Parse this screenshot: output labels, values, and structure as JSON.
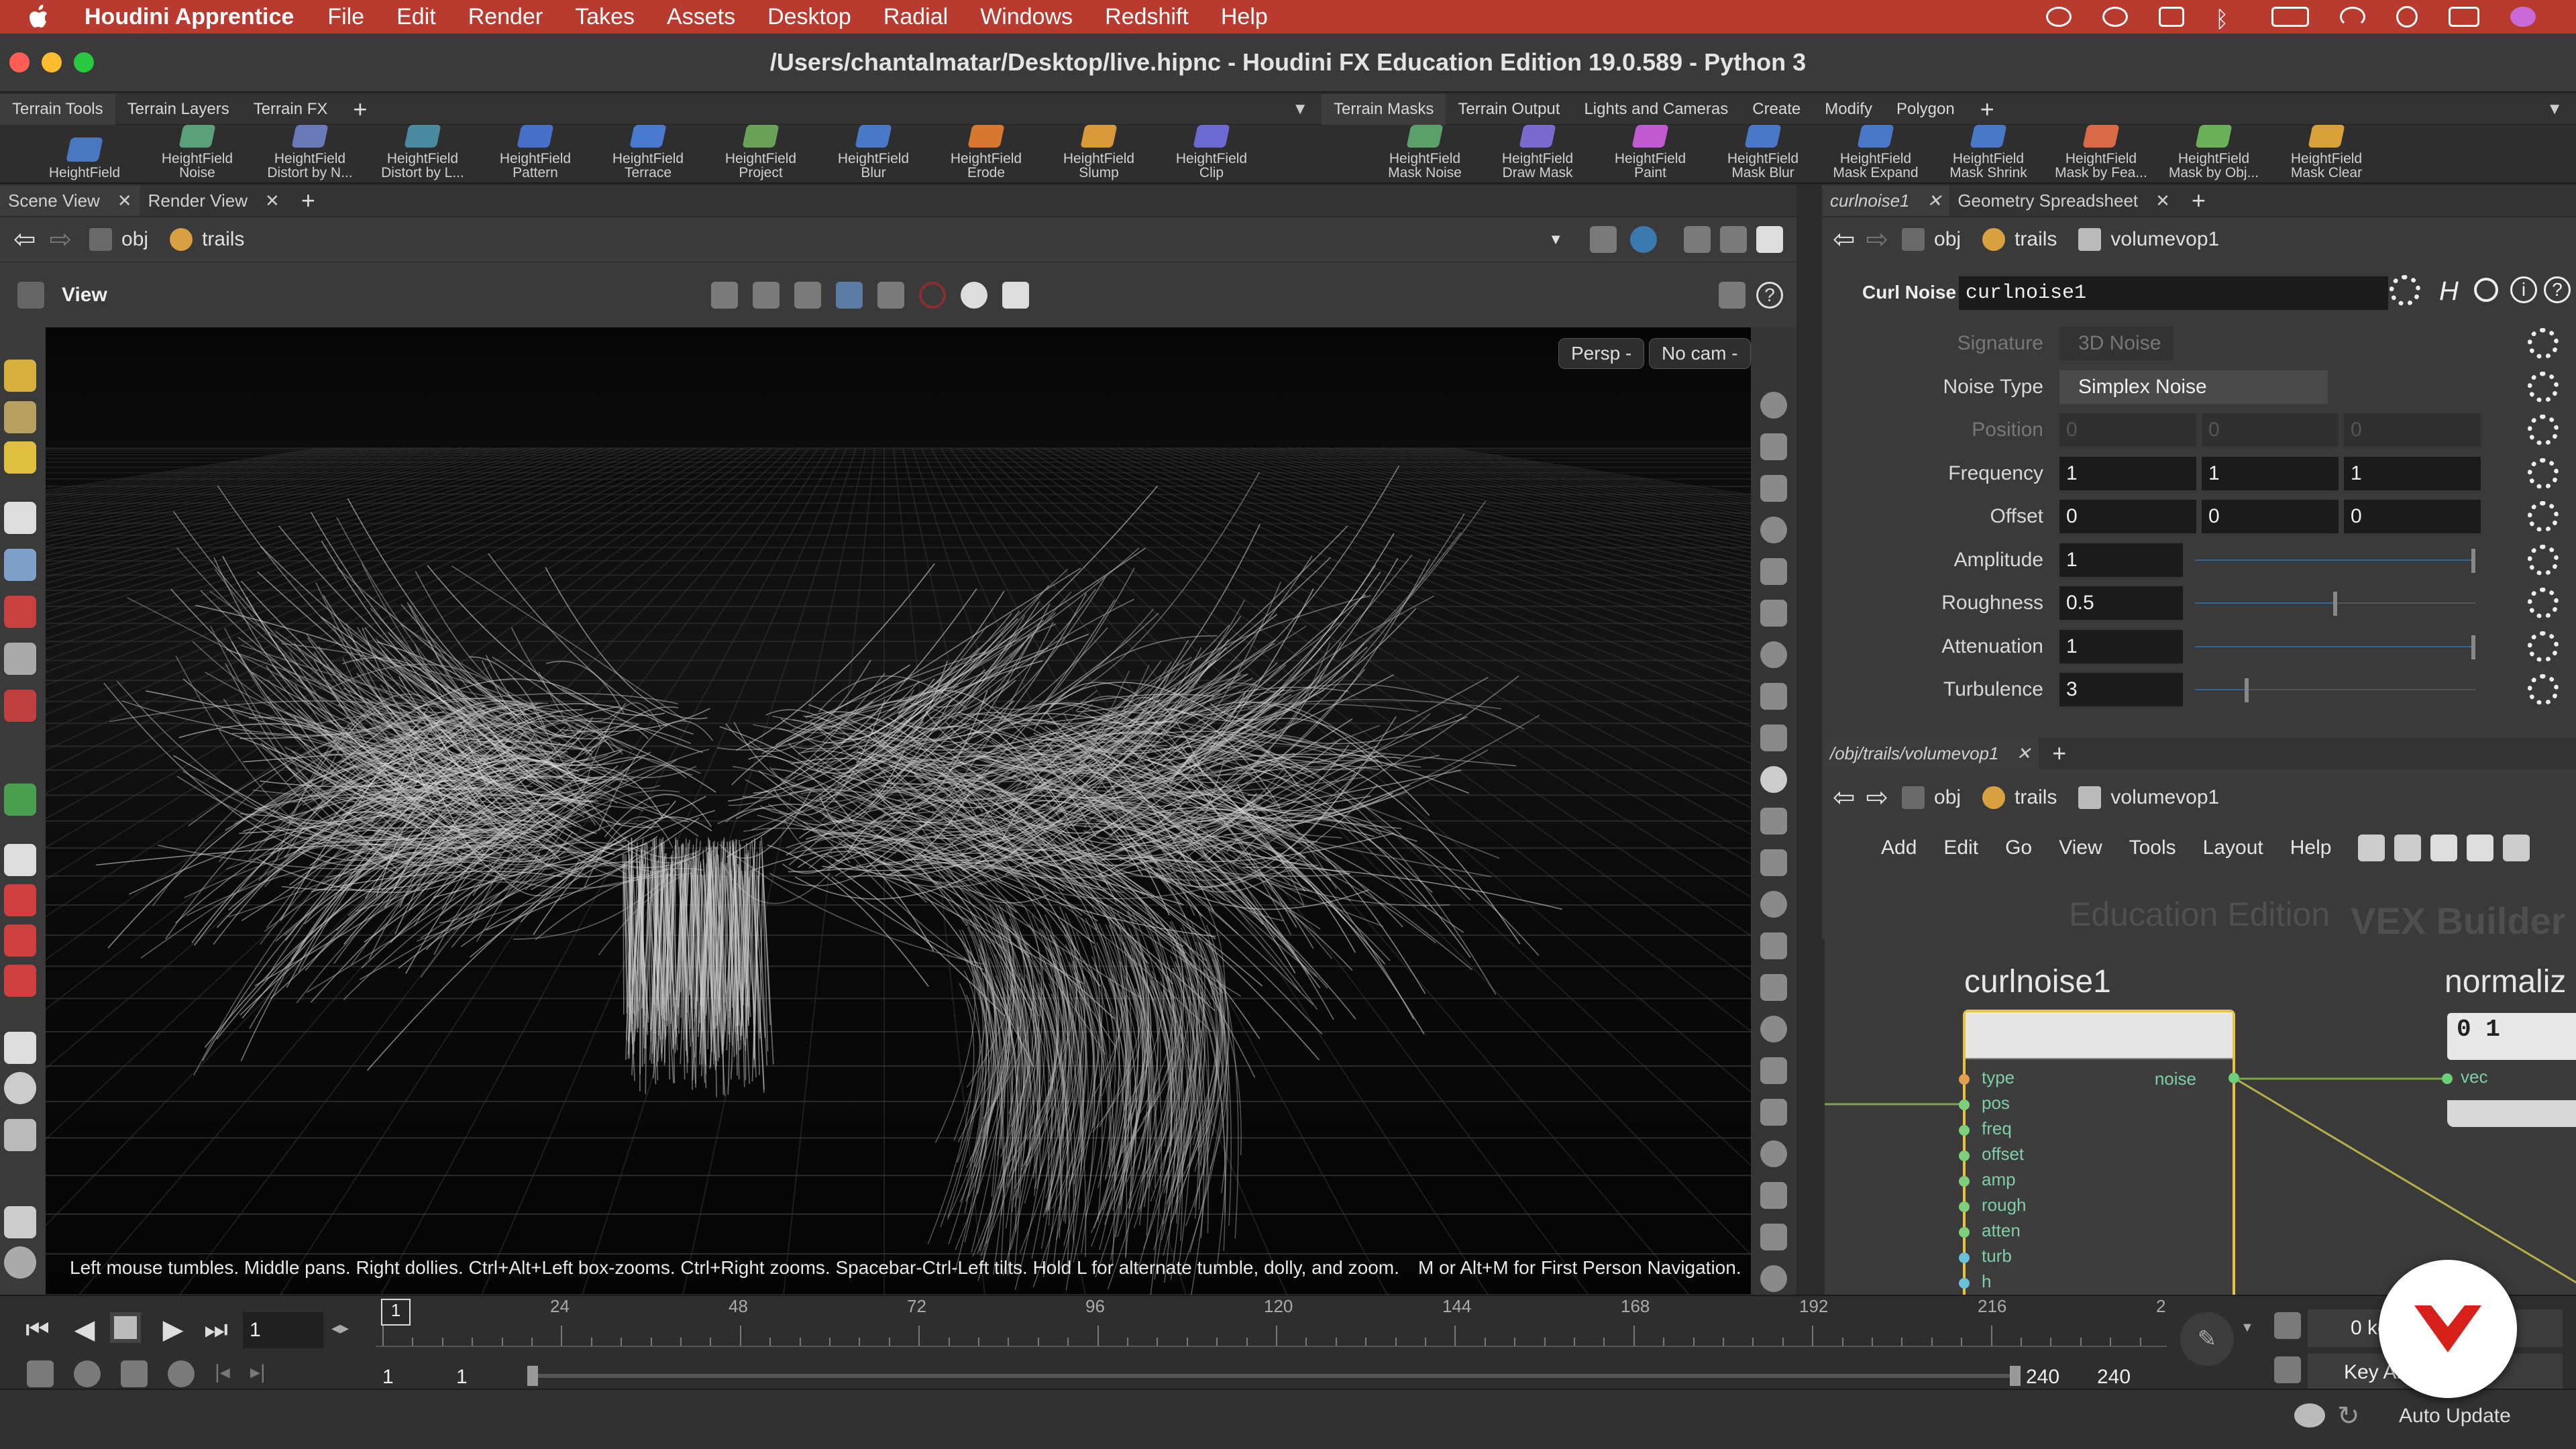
{
  "menubar": {
    "app": "Houdini Apprentice",
    "items": [
      "File",
      "Edit",
      "Render",
      "Takes",
      "Assets",
      "Desktop",
      "Radial",
      "Windows",
      "Redshift",
      "Help"
    ]
  },
  "window": {
    "title": "/Users/chantalmatar/Desktop/live.hipnc - Houdini FX Education Edition 19.0.589 - Python 3"
  },
  "shelf_left": {
    "tabs": [
      "Terrain Tools",
      "Terrain Layers",
      "Terrain FX"
    ],
    "tools": [
      [
        "HeightField",
        ""
      ],
      [
        "HeightField",
        "Noise"
      ],
      [
        "HeightField",
        "Distort by N..."
      ],
      [
        "HeightField",
        "Distort by L..."
      ],
      [
        "HeightField",
        "Pattern"
      ],
      [
        "HeightField",
        "Terrace"
      ],
      [
        "HeightField",
        "Project"
      ],
      [
        "HeightField",
        "Blur"
      ],
      [
        "HeightField",
        "Erode"
      ],
      [
        "HeightField",
        "Slump"
      ],
      [
        "HeightField",
        "Clip"
      ]
    ]
  },
  "shelf_right": {
    "tabs": [
      "Terrain Masks",
      "Terrain Output",
      "Lights and Cameras",
      "Create",
      "Modify",
      "Polygon"
    ],
    "tools": [
      [
        "HeightField",
        "Mask Noise"
      ],
      [
        "HeightField",
        "Draw Mask"
      ],
      [
        "HeightField",
        "Paint"
      ],
      [
        "HeightField",
        "Mask Blur"
      ],
      [
        "HeightField",
        "Mask Expand"
      ],
      [
        "HeightField",
        "Mask Shrink"
      ],
      [
        "HeightField",
        "Mask by Fea..."
      ],
      [
        "HeightField",
        "Mask by Obj..."
      ],
      [
        "HeightField",
        "Mask Clear"
      ]
    ]
  },
  "viewer": {
    "tabs": [
      "Scene View",
      "Render View"
    ],
    "path": [
      "obj",
      "trails"
    ],
    "title": "View",
    "persp": "Persp -",
    "cam": "No cam -",
    "hint": "Left mouse tumbles. Middle pans. Right dollies. Ctrl+Alt+Left box-zooms. Ctrl+Right zooms. Spacebar-Ctrl-Left tilts. Hold L for alternate tumble, dolly, and zoom.",
    "hint2": "M or Alt+M for First Person Navigation."
  },
  "params": {
    "tabs": [
      "curlnoise1",
      "Geometry Spreadsheet"
    ],
    "path": [
      "obj",
      "trails",
      "volumevop1"
    ],
    "node_type": "Curl Noise",
    "node_name": "curlnoise1",
    "rows": [
      {
        "label": "Signature",
        "value": "3D Noise",
        "kind": "menu",
        "dim": true
      },
      {
        "label": "Noise Type",
        "value": "Simplex Noise",
        "kind": "menu",
        "dim": false
      },
      {
        "label": "Position",
        "values": [
          "0",
          "0",
          "0"
        ],
        "kind": "vec",
        "dim": true
      },
      {
        "label": "Frequency",
        "values": [
          "1",
          "1",
          "1"
        ],
        "kind": "vec",
        "dim": false
      },
      {
        "label": "Offset",
        "values": [
          "0",
          "0",
          "0"
        ],
        "kind": "vec",
        "dim": false
      },
      {
        "label": "Amplitude",
        "value": "1",
        "kind": "slider",
        "level": 1.0
      },
      {
        "label": "Roughness",
        "value": "0.5",
        "kind": "slider",
        "level": 0.5
      },
      {
        "label": "Attenuation",
        "value": "1",
        "kind": "slider",
        "level": 1.0
      },
      {
        "label": "Turbulence",
        "value": "3",
        "kind": "slider",
        "level": 0.18
      }
    ]
  },
  "network": {
    "tab": "/obj/trails/volumevop1",
    "path": [
      "obj",
      "trails",
      "volumevop1"
    ],
    "menu": [
      "Add",
      "Edit",
      "Go",
      "View",
      "Tools",
      "Layout",
      "Help"
    ],
    "watermark": "Education Edition",
    "context": "VEX Builder",
    "node": "curlnoise1",
    "node2": "normaliz",
    "inputs": [
      "type",
      "pos",
      "freq",
      "offset",
      "amp",
      "rough",
      "atten",
      "turb",
      "h"
    ],
    "output": "noise",
    "node2_input": "vec",
    "node2_value": "0 1"
  },
  "timeline": {
    "frame": "1",
    "marker": "1",
    "ticks": [
      "24",
      "48",
      "72",
      "96",
      "120",
      "144",
      "168",
      "192",
      "216",
      "2"
    ],
    "start": "1",
    "start2": "1",
    "end": "240",
    "end2": "240",
    "keys": "0 ke",
    "keyall": "Key All",
    "update": "Auto Update"
  },
  "colors": {
    "menubar": "#b93a2f",
    "node_border": "#e8c43c",
    "port": "#7ecfa7",
    "logo": "#d8201b"
  }
}
